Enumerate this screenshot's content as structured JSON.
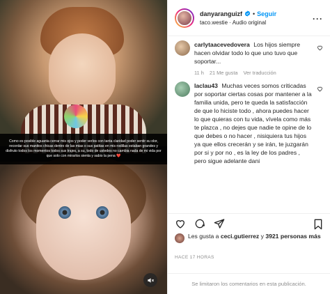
{
  "header": {
    "username": "danyaranguizf",
    "dot": "•",
    "follow_label": "Seguir",
    "audio_line": "taco.westie · Audio original",
    "more": "···"
  },
  "media": {
    "caption": "Como es posible aguanta cerrar mis ojos y poder verlos con tanta claridad poder sentir su olor, recordar sus manitos chicas dentro de las mias o sus patitas en mis rodillas estaban grandes y disfruto todos los momentos todos sus trajes, a su, todo de ustedes no cambia nada de mi vida por que solo con mirarlos sienta y sabio la pena ❤️"
  },
  "comments": [
    {
      "username": "carlytaacevedovera",
      "text": "Los hijos siempre hacen olvidar todo lo que uno tuvo que soportar...",
      "meta": [
        "11 h",
        "21 Me gusta",
        "Ver traducción"
      ],
      "avatar_color": "#c9a27e"
    },
    {
      "username": "laclau43",
      "text": "Muchas veces somos criticadas por soportar ciertas cosas por mantener a la familia unida, pero te queda la satisfacción de que lo hiciste todo , ahora puedes hacer lo que quieras con tu vida, vívela como más te plazca , no dejes que nadie te opine de lo que debes o no hacer , nisiquiera tus hijos ya que ellos crecerán y se irán, te juzgarán por si y por no , es la ley de los padres , pero sigue adelante dani",
      "meta": [],
      "avatar_color": "#6a9c7a"
    }
  ],
  "likes": {
    "prefix": "Les gusta a",
    "user": "ceci.gutierrez",
    "connector": "y",
    "count": "3921 personas más"
  },
  "time": "HACE 17 HORAS",
  "footer": "Se limitaron los comentarios en esta publicación.",
  "colors": {
    "accent": "#0095f6",
    "muted": "#8e8e8e",
    "text": "#262626"
  }
}
